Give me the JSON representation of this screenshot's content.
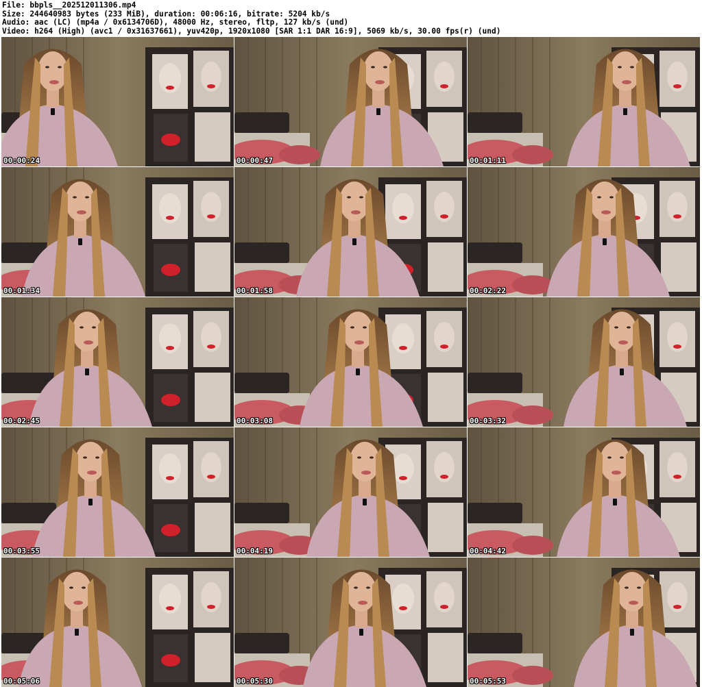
{
  "header": {
    "file_line": "File: bbpls__202512011306.mp4",
    "size_line": "Size: 244640983 bytes (233 MiB), duration: 00:06:16, bitrate: 5204 kb/s",
    "audio_line": "Audio: aac (LC) (mp4a / 0x6134706D), 48000 Hz, stereo, fltp, 127 kb/s (und)",
    "video_line": "Video: h264 (High) (avc1 / 0x31637661), yuv420p, 1920x1080 [SAR 1:1 DAR 16:9], 5069 kb/s, 30.00 fps(r) (und)"
  },
  "thumbnails": [
    {
      "timestamp": "00:00:24"
    },
    {
      "timestamp": "00:00:47"
    },
    {
      "timestamp": "00:01:11"
    },
    {
      "timestamp": "00:01:34"
    },
    {
      "timestamp": "00:01:58"
    },
    {
      "timestamp": "00:02:22"
    },
    {
      "timestamp": "00:02:45"
    },
    {
      "timestamp": "00:03:08"
    },
    {
      "timestamp": "00:03:32"
    },
    {
      "timestamp": "00:03:55"
    },
    {
      "timestamp": "00:04:19"
    },
    {
      "timestamp": "00:04:42"
    },
    {
      "timestamp": "00:05:06"
    },
    {
      "timestamp": "00:05:30"
    },
    {
      "timestamp": "00:05:53"
    }
  ],
  "colors": {
    "curtain": "#8a7a5e",
    "wall_poster": "#2a2522",
    "shirt": "#c9a8b3",
    "hair": "#b98a52",
    "pillow": "#c95a62",
    "lips": "#d0202a",
    "timestamp_text": "#ffffff"
  }
}
